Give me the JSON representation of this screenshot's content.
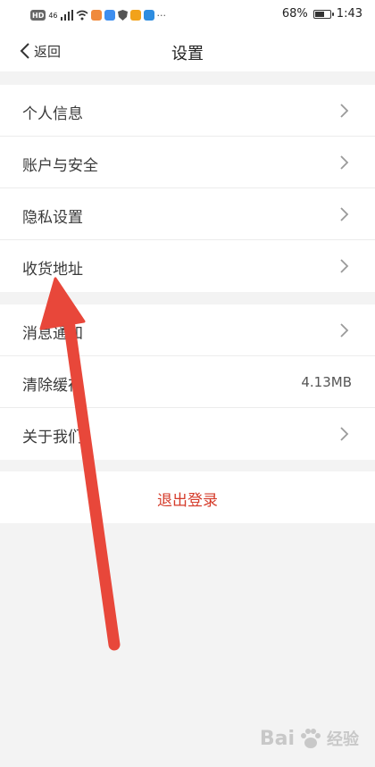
{
  "status_bar": {
    "left_badges": [
      "HD",
      "46"
    ],
    "battery_percent": "68%",
    "battery_level": 0.68,
    "time": "1:43",
    "more": "···"
  },
  "nav": {
    "back_label": "返回",
    "title": "设置"
  },
  "group1": {
    "items": [
      {
        "label": "个人信息"
      },
      {
        "label": "账户与安全"
      },
      {
        "label": "隐私设置"
      },
      {
        "label": "收货地址"
      }
    ]
  },
  "group2": {
    "items": [
      {
        "label": "消息通知"
      },
      {
        "label": "清除缓存",
        "value": "4.13MB"
      },
      {
        "label": "关于我们"
      }
    ]
  },
  "logout": {
    "label": "退出登录"
  },
  "colors": {
    "logout_text": "#d53b2a",
    "arrow": "#e8473a",
    "background": "#f3f3f3"
  },
  "watermark": {
    "brand": "Bai",
    "brand_tail": "经验"
  }
}
